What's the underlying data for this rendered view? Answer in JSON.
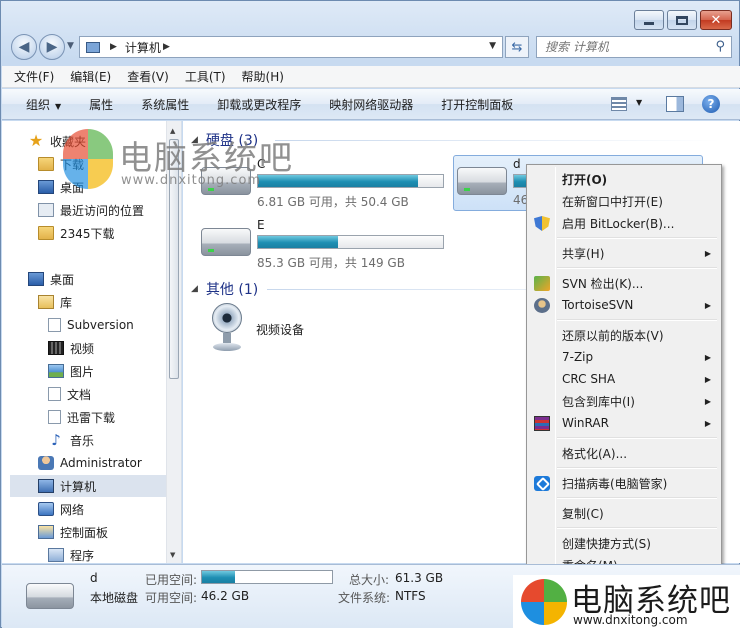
{
  "window": {
    "caption": {
      "minimize": "–",
      "maximize": "□",
      "close": "✕"
    }
  },
  "address": {
    "crumbs": [
      "计算机"
    ],
    "search_placeholder": "搜索 计算机"
  },
  "menubar": [
    "文件(F)",
    "编辑(E)",
    "查看(V)",
    "工具(T)",
    "帮助(H)"
  ],
  "toolbar": {
    "organize": "组织",
    "properties": "属性",
    "system_properties": "系统属性",
    "uninstall": "卸载或更改程序",
    "map_drive": "映射网络驱动器",
    "control_panel": "打开控制面板"
  },
  "nav": {
    "favorites": "收藏夹",
    "downloads": "下载",
    "desktop_fav": "桌面",
    "recent": "最近访问的位置",
    "download2345": "2345下载",
    "desktop": "桌面",
    "libraries": "库",
    "subversion": "Subversion",
    "video": "视频",
    "pictures": "图片",
    "documents": "文档",
    "xunlei": "迅雷下载",
    "music": "音乐",
    "administrator": "Administrator",
    "computer": "计算机",
    "network": "网络",
    "control_panel": "控制面板",
    "programs": "程序"
  },
  "content": {
    "group_hdd": "硬盘 (3)",
    "group_other": "其他 (1)",
    "drives": [
      {
        "name": "C",
        "info": "6.81 GB 可用，共 50.4 GB",
        "used_fraction": 0.865
      },
      {
        "name": "d",
        "info": "46.",
        "used_fraction": 0.25
      },
      {
        "name": "E",
        "info": "85.3 GB 可用，共 149 GB",
        "used_fraction": 0.43
      }
    ],
    "webcam": "视频设备"
  },
  "context_menu": {
    "open": "打开(O)",
    "open_new_window": "在新窗口中打开(E)",
    "bitlocker": "启用 BitLocker(B)...",
    "share": "共享(H)",
    "svn_checkout": "SVN 检出(K)...",
    "tortoise": "TortoiseSVN",
    "restore": "还原以前的版本(V)",
    "zip": "7-Zip",
    "crc": "CRC SHA",
    "library": "包含到库中(I)",
    "winrar": "WinRAR",
    "format": "格式化(A)...",
    "scan": "扫描病毒(电脑管家)",
    "copy": "复制(C)",
    "shortcut": "创建快捷方式(S)",
    "rename": "重命名(M)"
  },
  "details": {
    "name": "d",
    "type": "本地磁盘",
    "used_label": "已用空间:",
    "free_label": "可用空间:",
    "free_value": "46.2 GB",
    "total_label": "总大小:",
    "total_value": "61.3 GB",
    "fs_label": "文件系统:",
    "fs_value": "NTFS",
    "used_fraction": 0.25
  },
  "watermark": {
    "title": "电脑系统吧",
    "url": "www.dnxitong.com",
    "colors": [
      "#e64a2e",
      "#52b043",
      "#1e8fe0",
      "#f4b400"
    ]
  }
}
